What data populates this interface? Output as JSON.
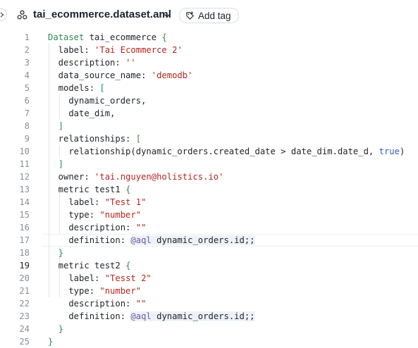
{
  "header": {
    "file_name": "tai_ecommerce.dataset.aml",
    "add_tag_label": "Add tag",
    "file_icon": "dataset-icon",
    "tag_icon": "tag-plus-icon",
    "dropdown_icon": "chevron-down-icon",
    "sidebar_toggle_icon": "chevron-right-icon"
  },
  "editor": {
    "active_line": 19,
    "lines": [
      {
        "n": "1",
        "t": "Dataset tai_ecommerce {"
      },
      {
        "n": "2",
        "t": "  label: 'Tai Ecommerce 2'"
      },
      {
        "n": "3",
        "t": "  description: ''"
      },
      {
        "n": "4",
        "t": "  data_source_name: 'demodb'"
      },
      {
        "n": "5",
        "t": "  models: ["
      },
      {
        "n": "6",
        "t": "    dynamic_orders,"
      },
      {
        "n": "7",
        "t": "    date_dim,"
      },
      {
        "n": "8",
        "t": "  ]"
      },
      {
        "n": "9",
        "t": "  relationships: ["
      },
      {
        "n": "10",
        "t": "    relationship(dynamic_orders.created_date > date_dim.date_d, true)"
      },
      {
        "n": "11",
        "t": "  ]"
      },
      {
        "n": "12",
        "t": "  owner: 'tai.nguyen@holistics.io'"
      },
      {
        "n": "13",
        "t": "  metric test1 {"
      },
      {
        "n": "14",
        "t": "    label: \"Test 1\""
      },
      {
        "n": "15",
        "t": "    type: \"number\""
      },
      {
        "n": "16",
        "t": "    description: \"\""
      },
      {
        "n": "17",
        "t": "    definition: @aql dynamic_orders.id;;"
      },
      {
        "n": "18",
        "t": "  }"
      },
      {
        "n": "19",
        "t": "  metric test2 {"
      },
      {
        "n": "20",
        "t": "    label: \"Tesst 2\""
      },
      {
        "n": "21",
        "t": "    type: \"number\""
      },
      {
        "n": "22",
        "t": "    description: \"\""
      },
      {
        "n": "23",
        "t": "    definition: @aql dynamic_orders.id;;"
      },
      {
        "n": "24",
        "t": "  }"
      },
      {
        "n": "25",
        "t": "}"
      }
    ]
  }
}
